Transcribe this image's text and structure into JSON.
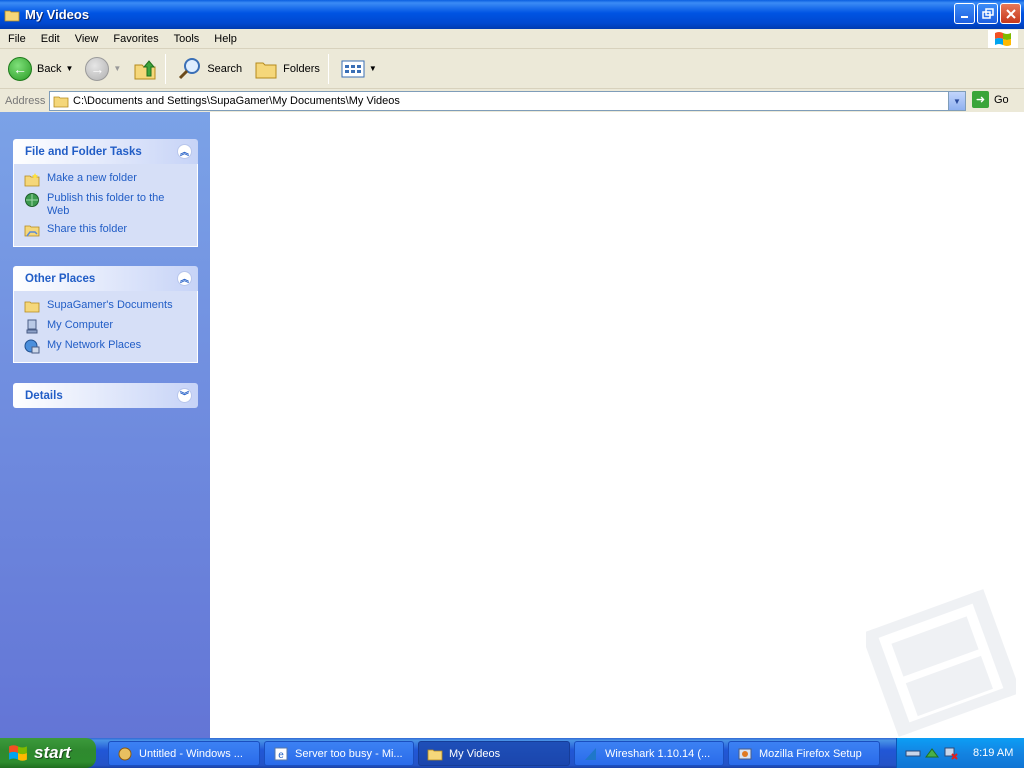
{
  "window": {
    "title": "My Videos"
  },
  "menu": [
    "File",
    "Edit",
    "View",
    "Favorites",
    "Tools",
    "Help"
  ],
  "toolbar": {
    "back_label": "Back",
    "search_label": "Search",
    "folders_label": "Folders"
  },
  "address": {
    "label": "Address",
    "value": "C:\\Documents and Settings\\SupaGamer\\My Documents\\My Videos",
    "go_label": "Go"
  },
  "panels": {
    "file_tasks": {
      "title": "File and Folder Tasks",
      "items": [
        "Make a new folder",
        "Publish this folder to the Web",
        "Share this folder"
      ]
    },
    "other_places": {
      "title": "Other Places",
      "items": [
        "SupaGamer's Documents",
        "My Computer",
        "My Network Places"
      ]
    },
    "details": {
      "title": "Details"
    }
  },
  "taskbar": {
    "start_label": "start",
    "items": [
      "Untitled - Windows ...",
      "Server too busy - Mi...",
      "My Videos",
      "Wireshark 1.10.14 (...",
      "Mozilla Firefox Setup"
    ],
    "clock": "8:19 AM"
  },
  "colors": {
    "titlebar": "#0054e3",
    "taskpane": "#6375d6",
    "link": "#215dc6",
    "start": "#2f8a2f"
  }
}
